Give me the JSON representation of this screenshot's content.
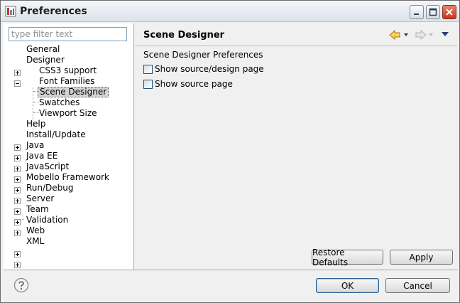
{
  "window": {
    "title": "Preferences"
  },
  "filter": {
    "placeholder": "type filter text"
  },
  "tree": {
    "items": [
      {
        "label": "General"
      },
      {
        "label": "Designer"
      },
      {
        "label": "CSS3 support"
      },
      {
        "label": "Font Families"
      },
      {
        "label": "Scene Designer"
      },
      {
        "label": "Swatches"
      },
      {
        "label": "Viewport Size"
      },
      {
        "label": "Help"
      },
      {
        "label": "Install/Update"
      },
      {
        "label": "Java"
      },
      {
        "label": "Java EE"
      },
      {
        "label": "JavaScript"
      },
      {
        "label": "Mobello Framework"
      },
      {
        "label": "Run/Debug"
      },
      {
        "label": "Server"
      },
      {
        "label": "Team"
      },
      {
        "label": "Validation"
      },
      {
        "label": "Web"
      },
      {
        "label": "XML"
      }
    ]
  },
  "page": {
    "title": "Scene Designer",
    "section_label": "Scene Designer Preferences",
    "options": [
      {
        "label": "Show source/design page",
        "checked": false
      },
      {
        "label": "Show source page",
        "checked": false
      }
    ]
  },
  "buttons": {
    "restore_defaults": "Restore Defaults",
    "apply": "Apply",
    "ok": "OK",
    "cancel": "Cancel"
  },
  "icons": {
    "app": "preferences-app-icon",
    "back": "back-arrow-icon",
    "forward": "forward-arrow-icon",
    "menu": "view-menu-icon",
    "help": "help-icon"
  },
  "colors": {
    "selection": "#d4d4d4",
    "close_button": "#c1391c"
  }
}
